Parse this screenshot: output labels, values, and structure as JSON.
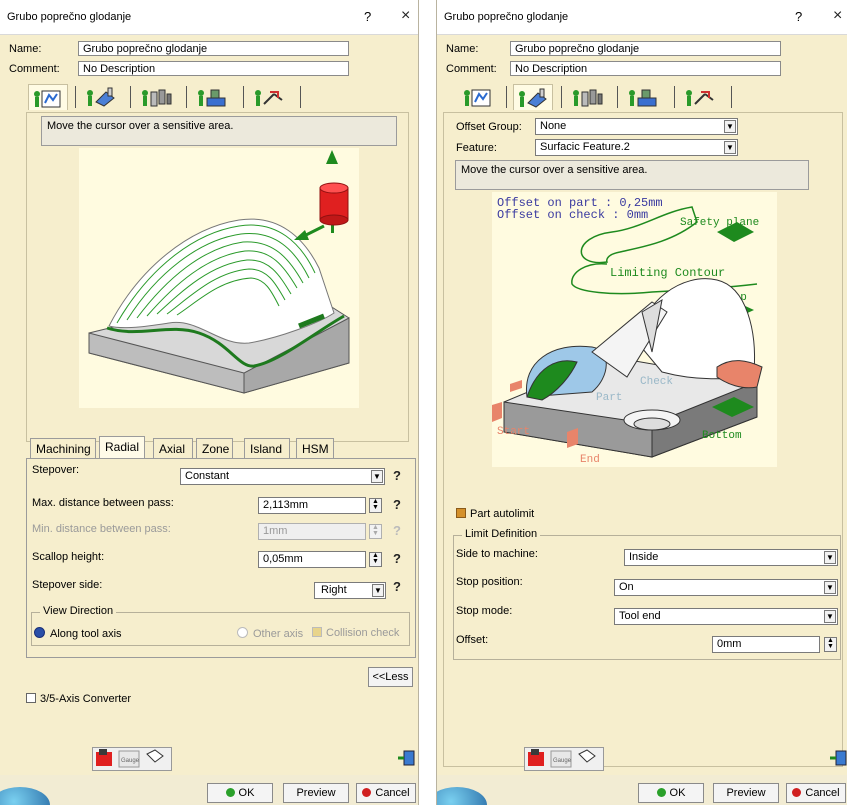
{
  "left": {
    "title": "Grubo poprečno glodanje",
    "help": "?",
    "close": "×",
    "name_label": "Name:",
    "name_value": "Grubo poprečno glodanje",
    "comment_label": "Comment:",
    "comment_value": "No Description",
    "info": "Move the cursor over a sensitive area.",
    "tabs": [
      "Machining",
      "Radial",
      "Axial",
      "Zone",
      "Island",
      "HSM"
    ],
    "active_tab": "Radial",
    "stepover_label": "Stepover:",
    "stepover_value": "Constant",
    "maxdist_label": "Max. distance between pass:",
    "maxdist_value": "2,113mm",
    "mindist_label": "Min. distance between pass:",
    "mindist_value": "1mm",
    "scallop_label": "Scallop height:",
    "scallop_value": "0,05mm",
    "side_label": "Stepover side:",
    "side_value": "Right",
    "view_dir_title": "View Direction",
    "along_axis": "Along tool axis",
    "other_axis": "Other axis",
    "collision": "Collision check",
    "less_button": "<<Less",
    "converter": "3/5-Axis Converter",
    "ok": "OK",
    "preview": "Preview",
    "cancel": "Cancel",
    "q": "?"
  },
  "right": {
    "title": "Grubo poprečno glodanje",
    "help": "?",
    "close": "×",
    "name_label": "Name:",
    "name_value": "Grubo poprečno glodanje",
    "comment_label": "Comment:",
    "comment_value": "No Description",
    "offset_group_label": "Offset Group:",
    "offset_group_value": "None",
    "feature_label": "Feature:",
    "feature_value": "Surfacic Feature.2",
    "info": "Move the cursor over a sensitive area.",
    "diagram": {
      "offset_part": "Offset on part : 0,25mm",
      "offset_check": "Offset on check : 0mm",
      "safety_plane": "Safety plane",
      "limiting_contour": "Limiting Contour",
      "top": "Top",
      "check": "Check",
      "part": "Part",
      "start": "Start",
      "end": "End",
      "bottom": "Bottom"
    },
    "part_autolimit": "Part autolimit",
    "limit_def_title": "Limit Definition",
    "side_label": "Side to machine:",
    "side_value": "Inside",
    "stop_pos_label": "Stop position:",
    "stop_pos_value": "On",
    "stop_mode_label": "Stop mode:",
    "stop_mode_value": "Tool end",
    "offset_label": "Offset:",
    "offset_value": "0mm",
    "ok": "OK",
    "preview": "Preview",
    "cancel": "Cancel"
  },
  "colors": {
    "panel_bg": "#f6eecd",
    "diagram_bg": "#fffbe0",
    "green": "#1e8a1e",
    "red": "#e02020",
    "salmon": "#e8846a",
    "blue_radio": "#2a4fa8"
  }
}
